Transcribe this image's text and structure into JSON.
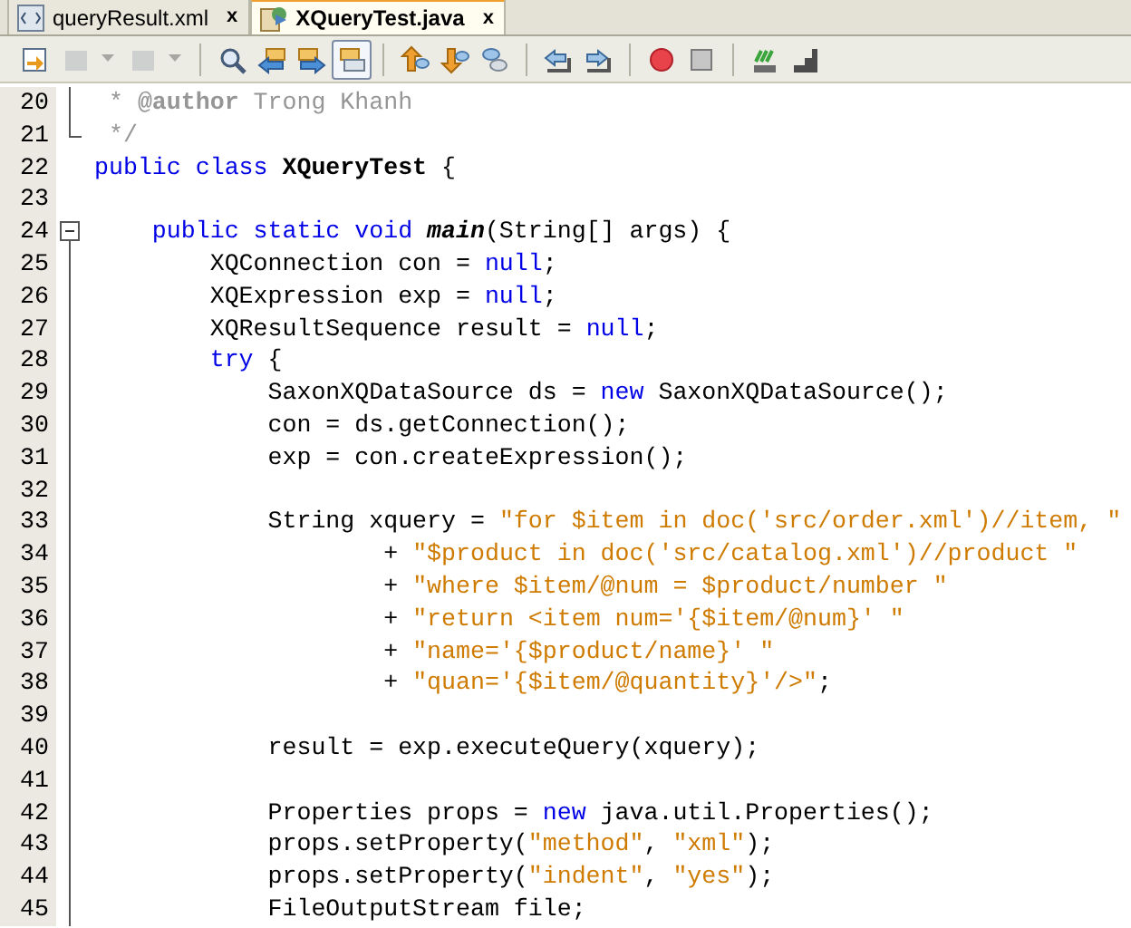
{
  "tabs": [
    {
      "label": "queryResult.xml",
      "close": "x",
      "selected": false,
      "kind": "xml"
    },
    {
      "label": "XQueryTest.java",
      "close": "x",
      "selected": true,
      "kind": "java"
    }
  ],
  "toolbar": [
    {
      "kind": "last-edit",
      "disabled": false,
      "dropdown": false,
      "selected": false
    },
    {
      "kind": "back",
      "disabled": true,
      "dropdown": true,
      "selected": false
    },
    {
      "kind": "forward",
      "disabled": true,
      "dropdown": true,
      "selected": false
    },
    {
      "kind": "sep"
    },
    {
      "kind": "find",
      "disabled": false,
      "dropdown": false,
      "selected": false
    },
    {
      "kind": "find-prev",
      "disabled": false,
      "dropdown": false,
      "selected": false
    },
    {
      "kind": "find-next",
      "disabled": false,
      "dropdown": false,
      "selected": false
    },
    {
      "kind": "highlight",
      "disabled": false,
      "dropdown": false,
      "selected": true
    },
    {
      "kind": "sep"
    },
    {
      "kind": "bookmark-prev",
      "disabled": false,
      "dropdown": false,
      "selected": false
    },
    {
      "kind": "bookmark-next",
      "disabled": false,
      "dropdown": false,
      "selected": false
    },
    {
      "kind": "bookmark-toggle",
      "disabled": false,
      "dropdown": false,
      "selected": false
    },
    {
      "kind": "sep"
    },
    {
      "kind": "shift-left",
      "disabled": false,
      "dropdown": false,
      "selected": false
    },
    {
      "kind": "shift-right",
      "disabled": false,
      "dropdown": false,
      "selected": false
    },
    {
      "kind": "sep"
    },
    {
      "kind": "record",
      "disabled": false,
      "dropdown": false,
      "selected": false
    },
    {
      "kind": "stop",
      "disabled": false,
      "dropdown": false,
      "selected": false
    },
    {
      "kind": "sep"
    },
    {
      "kind": "check",
      "disabled": false,
      "dropdown": false,
      "selected": false
    },
    {
      "kind": "stairs",
      "disabled": false,
      "dropdown": false,
      "selected": false
    }
  ],
  "lines": [
    {
      "number": "20",
      "kind": "fold-body",
      "segments": [
        {
          "kind": "comment",
          "text": " * "
        },
        {
          "kind": "comment-tag",
          "text": "@author"
        },
        {
          "kind": "comment",
          "text": " Trong Khanh"
        }
      ]
    },
    {
      "number": "21",
      "kind": "fold-end",
      "segments": [
        {
          "kind": "comment",
          "text": " */"
        }
      ]
    },
    {
      "number": "22",
      "kind": "plain",
      "segments": [
        {
          "kind": "keyword",
          "text": "public class "
        },
        {
          "kind": "bold",
          "text": "XQueryTest"
        },
        {
          "kind": "plain",
          "text": " {"
        }
      ]
    },
    {
      "number": "23",
      "kind": "plain"
    },
    {
      "number": "24",
      "kind": "fold-start",
      "expanded": true,
      "segments": [
        {
          "kind": "keyword",
          "text": "    public static void "
        },
        {
          "kind": "bold-italic",
          "text": "main"
        },
        {
          "kind": "plain",
          "text": "(String[] args) {"
        }
      ]
    },
    {
      "number": "25",
      "kind": "fold-body",
      "segments": [
        {
          "kind": "plain",
          "text": "        XQConnection con = "
        },
        {
          "kind": "keyword",
          "text": "null"
        },
        {
          "kind": "plain",
          "text": ";"
        }
      ]
    },
    {
      "number": "26",
      "kind": "fold-body",
      "segments": [
        {
          "kind": "plain",
          "text": "        XQExpression exp = "
        },
        {
          "kind": "keyword",
          "text": "null"
        },
        {
          "kind": "plain",
          "text": ";"
        }
      ]
    },
    {
      "number": "27",
      "kind": "fold-body",
      "segments": [
        {
          "kind": "plain",
          "text": "        XQResultSequence result = "
        },
        {
          "kind": "keyword",
          "text": "null"
        },
        {
          "kind": "plain",
          "text": ";"
        }
      ]
    },
    {
      "number": "28",
      "kind": "fold-body",
      "segments": [
        {
          "kind": "keyword",
          "text": "        try"
        },
        {
          "kind": "plain",
          "text": " {"
        }
      ]
    },
    {
      "number": "29",
      "kind": "fold-body",
      "segments": [
        {
          "kind": "plain",
          "text": "            SaxonXQDataSource ds = "
        },
        {
          "kind": "keyword",
          "text": "new"
        },
        {
          "kind": "plain",
          "text": " SaxonXQDataSource();"
        }
      ]
    },
    {
      "number": "30",
      "kind": "fold-body",
      "segments": [
        {
          "kind": "plain",
          "text": "            con = ds.getConnection();"
        }
      ]
    },
    {
      "number": "31",
      "kind": "fold-body",
      "segments": [
        {
          "kind": "plain",
          "text": "            exp = con.createExpression();"
        }
      ]
    },
    {
      "number": "32",
      "kind": "fold-body"
    },
    {
      "number": "33",
      "kind": "fold-body",
      "segments": [
        {
          "kind": "plain",
          "text": "            String xquery = "
        },
        {
          "kind": "string",
          "text": "\"for $item in doc('src/order.xml')//item, \""
        }
      ]
    },
    {
      "number": "34",
      "kind": "fold-body",
      "segments": [
        {
          "kind": "plain",
          "text": "                    + "
        },
        {
          "kind": "string",
          "text": "\"$product in doc('src/catalog.xml')//product \""
        }
      ]
    },
    {
      "number": "35",
      "kind": "fold-body",
      "segments": [
        {
          "kind": "plain",
          "text": "                    + "
        },
        {
          "kind": "string",
          "text": "\"where $item/@num = $product/number \""
        }
      ]
    },
    {
      "number": "36",
      "kind": "fold-body",
      "segments": [
        {
          "kind": "plain",
          "text": "                    + "
        },
        {
          "kind": "string",
          "text": "\"return <item num='{$item/@num}' \""
        }
      ]
    },
    {
      "number": "37",
      "kind": "fold-body",
      "segments": [
        {
          "kind": "plain",
          "text": "                    + "
        },
        {
          "kind": "string",
          "text": "\"name='{$product/name}' \""
        }
      ]
    },
    {
      "number": "38",
      "kind": "fold-body",
      "segments": [
        {
          "kind": "plain",
          "text": "                    + "
        },
        {
          "kind": "string",
          "text": "\"quan='{$item/@quantity}'/>\""
        },
        {
          "kind": "plain",
          "text": ";"
        }
      ]
    },
    {
      "number": "39",
      "kind": "fold-body"
    },
    {
      "number": "40",
      "kind": "fold-body",
      "segments": [
        {
          "kind": "plain",
          "text": "            result = exp.executeQuery(xquery);"
        }
      ]
    },
    {
      "number": "41",
      "kind": "fold-body"
    },
    {
      "number": "42",
      "kind": "fold-body",
      "segments": [
        {
          "kind": "plain",
          "text": "            Properties props = "
        },
        {
          "kind": "keyword",
          "text": "new"
        },
        {
          "kind": "plain",
          "text": " java.util.Properties();"
        }
      ]
    },
    {
      "number": "43",
      "kind": "fold-body",
      "segments": [
        {
          "kind": "plain",
          "text": "            props.setProperty("
        },
        {
          "kind": "string",
          "text": "\"method\""
        },
        {
          "kind": "plain",
          "text": ", "
        },
        {
          "kind": "string",
          "text": "\"xml\""
        },
        {
          "kind": "plain",
          "text": ");"
        }
      ]
    },
    {
      "number": "44",
      "kind": "fold-body",
      "segments": [
        {
          "kind": "plain",
          "text": "            props.setProperty("
        },
        {
          "kind": "string",
          "text": "\"indent\""
        },
        {
          "kind": "plain",
          "text": ", "
        },
        {
          "kind": "string",
          "text": "\"yes\""
        },
        {
          "kind": "plain",
          "text": ");"
        }
      ]
    },
    {
      "number": "45",
      "kind": "fold-body",
      "segments": [
        {
          "kind": "plain",
          "text": "            FileOutputStream file;"
        }
      ]
    }
  ]
}
